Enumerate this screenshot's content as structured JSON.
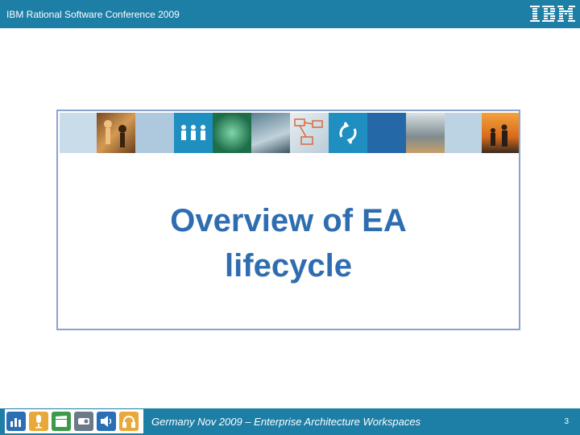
{
  "header": {
    "title": "IBM Rational Software Conference 2009"
  },
  "slide": {
    "title_line1": "Overview of EA",
    "title_line2": "lifecycle"
  },
  "footer": {
    "text": "Germany Nov 2009 – Enterprise Architecture Workspaces",
    "page_number": "3",
    "icons": [
      "chart-icon",
      "microphone-icon",
      "clapper-icon",
      "projector-icon",
      "speaker-icon",
      "headphones-icon"
    ]
  },
  "colors": {
    "header_bar": "#1d7ea6",
    "title_text": "#2e6eb0",
    "card_border": "#8aa2d3"
  }
}
